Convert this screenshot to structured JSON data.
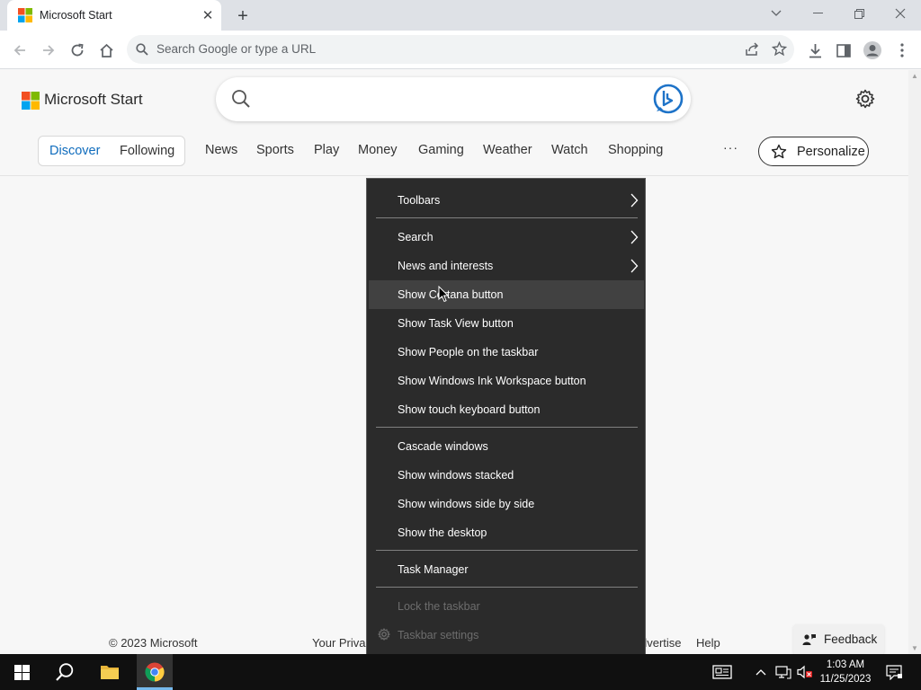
{
  "browser": {
    "tab_title": "Microsoft Start",
    "new_tab": "+",
    "omnibox_placeholder": "Search Google or type a URL"
  },
  "msstart": {
    "brand": "Microsoft Start",
    "pivot": {
      "discover": "Discover",
      "following": "Following"
    },
    "nav": [
      "News",
      "Sports",
      "Play",
      "Money",
      "Gaming",
      "Weather",
      "Watch",
      "Shopping"
    ],
    "more": "···",
    "personalize": "Personalize",
    "footer": {
      "copyright": "© 2023 Microsoft",
      "privacy": "Your Privac",
      "advertise": "dvertise",
      "help": "Help"
    },
    "feedback": "Feedback"
  },
  "context_menu": {
    "items": [
      {
        "label": "Toolbars",
        "submenu": true
      },
      {
        "label": "Search",
        "submenu": true
      },
      {
        "label": "News and interests",
        "submenu": true
      },
      {
        "label": "Show Cortana button",
        "hovered": true
      },
      {
        "label": "Show Task View button"
      },
      {
        "label": "Show People on the taskbar"
      },
      {
        "label": "Show Windows Ink Workspace button"
      },
      {
        "label": "Show touch keyboard button"
      },
      {
        "label": "Cascade windows"
      },
      {
        "label": "Show windows stacked"
      },
      {
        "label": "Show windows side by side"
      },
      {
        "label": "Show the desktop"
      },
      {
        "label": "Task Manager"
      },
      {
        "label": "Lock the taskbar",
        "disabled": true
      },
      {
        "label": "Taskbar settings",
        "disabled": true
      }
    ]
  },
  "taskbar": {
    "time": "1:03 AM",
    "date": "11/25/2023"
  },
  "colors": {
    "accent": "#0f6cbd",
    "menu_bg": "#2b2b2b",
    "menu_hover": "#414141",
    "taskbar_bg": "#101010"
  },
  "icons": [
    "windows-start-icon",
    "search-icon",
    "file-explorer-icon",
    "chrome-icon",
    "news-icon",
    "chevron-up-icon",
    "network-icon",
    "volume-muted-icon",
    "notification-icon"
  ]
}
